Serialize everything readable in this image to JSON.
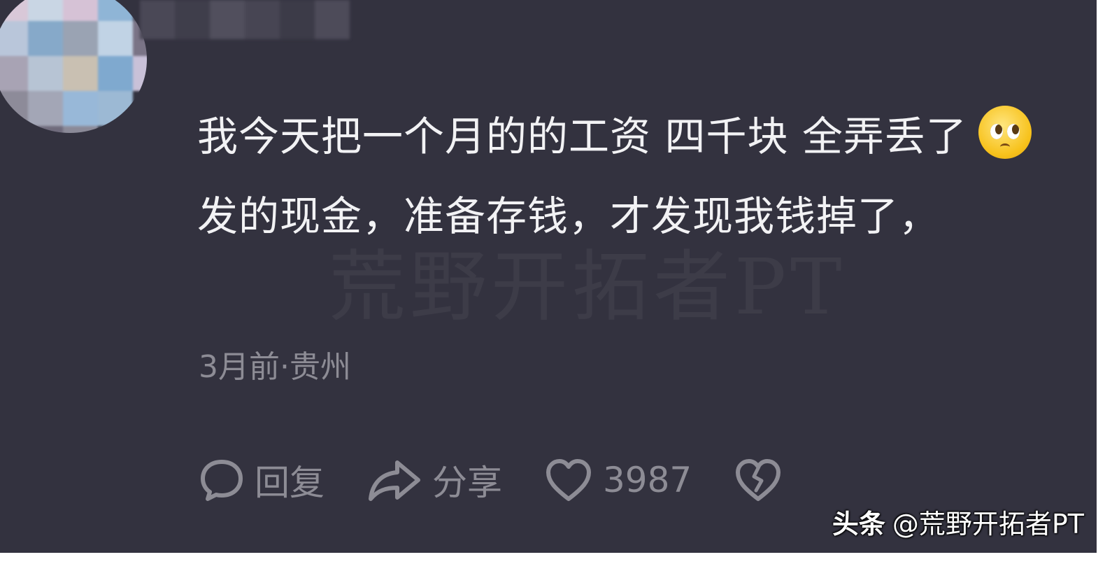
{
  "comment": {
    "text_line_part1": "我今天把一个月的的工资 四千块 全弄丢了",
    "emoji": "pleading-face-emoji",
    "text_line_part2": "发的现金，准备存钱，才发现我钱掉了，",
    "time_location": "3月前·贵州"
  },
  "actions": {
    "reply_label": "回复",
    "share_label": "分享",
    "like_count": "3987"
  },
  "watermark": {
    "center_text": "荒野开拓者PT",
    "brand": "头条",
    "handle": "@荒野开拓者PT"
  },
  "colors": {
    "background": "#33323f",
    "text": "#f2f2f4",
    "muted": "#8d8c95"
  }
}
